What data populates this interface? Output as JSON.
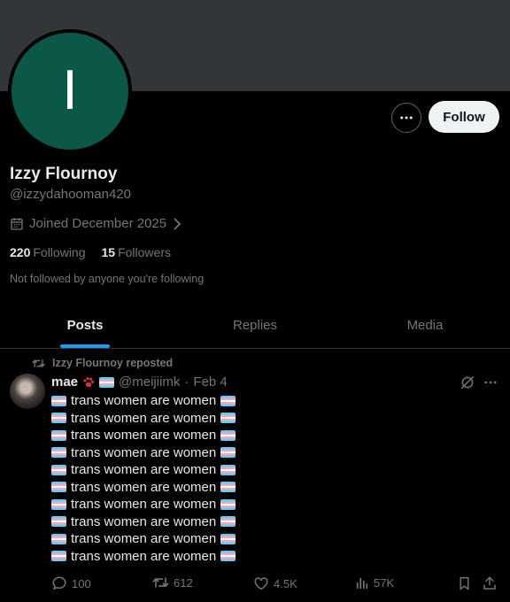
{
  "profile": {
    "avatar_letter": "I",
    "avatar_color": "#0b5849",
    "name": "Izzy Flournoy",
    "handle": "@izzydahooman420",
    "joined": "Joined December 2025",
    "following_count": "220",
    "following_label": "Following",
    "followers_count": "15",
    "followers_label": "Followers",
    "not_followed_text": "Not followed by anyone you're following"
  },
  "buttons": {
    "follow_label": "Follow",
    "more_icon": "more-horizontal-icon"
  },
  "tabs": [
    {
      "label": "Posts",
      "active": true
    },
    {
      "label": "Replies",
      "active": false
    },
    {
      "label": "Media",
      "active": false
    }
  ],
  "post": {
    "repost_text": "Izzy Flournoy reposted",
    "author_name": "mae",
    "author_handle": "@meijiimk",
    "separator": "·",
    "date": "Feb 4",
    "lines": [
      "trans women are women",
      "trans women are women",
      "trans women are women",
      "trans women are women",
      "trans women are women",
      "trans women are women",
      "trans women are women",
      "trans women are women",
      "trans women are women",
      "trans women are women"
    ],
    "replies": "100",
    "reposts": "612",
    "likes": "4.5K",
    "views": "57K"
  },
  "colors": {
    "accent": "#1d9bf0",
    "background": "#000000",
    "banner": "#333639",
    "muted_text": "#71767b"
  }
}
